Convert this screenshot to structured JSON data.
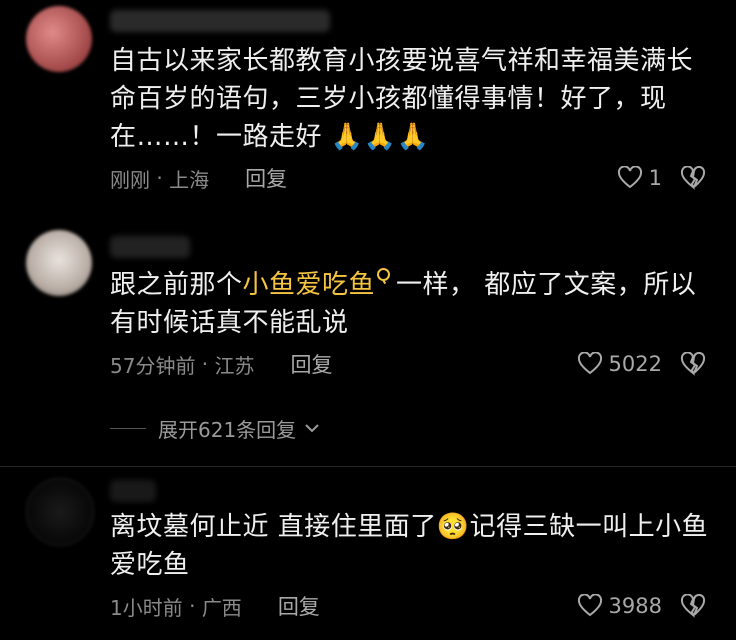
{
  "comments": [
    {
      "username": "",
      "text_parts": [
        "自古以来家长都教育小孩要说喜气祥和幸福美满长命百岁的语句，三岁小孩都懂得事情！好了，现在……！一路走好 ",
        "🙏🙏🙏"
      ],
      "time": "刚刚",
      "location": "上海",
      "reply_label": "回复",
      "likes": "1"
    },
    {
      "username": "",
      "text_before": "跟之前那个",
      "highlight": "小鱼爱吃鱼",
      "text_after": "一样，  都应了文案，所以有时候话真不能乱说",
      "time": "57分钟前",
      "location": "江苏",
      "reply_label": "回复",
      "likes": "5022"
    },
    {
      "username": "",
      "text_before": "离坟墓何止近 直接住里面了",
      "emoji": "🥺",
      "text_after": "记得三缺一叫上小鱼爱吃鱼",
      "time": "1小时前",
      "location": "广西",
      "reply_label": "回复",
      "likes": "3988"
    }
  ],
  "expand_replies": "展开621条回复",
  "colors": {
    "background": "#000000",
    "highlight": "#f5c542",
    "meta": "#8a8a8a"
  },
  "icons": {
    "like": "heart-outline-icon",
    "dislike": "broken-heart-icon",
    "search": "search-icon",
    "expand": "chevron-down-icon"
  }
}
